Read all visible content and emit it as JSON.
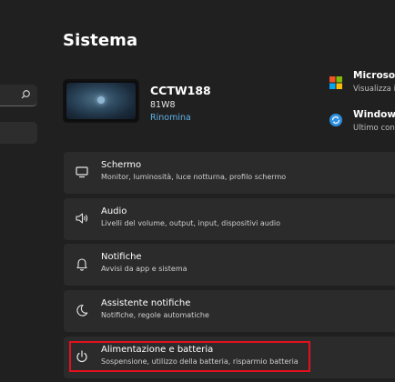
{
  "page": {
    "title": "Sistema"
  },
  "device": {
    "name": "CCTW188",
    "model": "81W8",
    "rename_label": "Rinomina"
  },
  "promos": [
    {
      "title": "Microsoft",
      "subtitle": "Visualizza i v",
      "icon": "microsoft-logo-icon"
    },
    {
      "title": "Windows U",
      "subtitle": "Ultimo cont",
      "icon": "windows-update-icon"
    }
  ],
  "settings": [
    {
      "title": "Schermo",
      "subtitle": "Monitor, luminosità, luce notturna, profilo schermo",
      "icon": "display-icon"
    },
    {
      "title": "Audio",
      "subtitle": "Livelli del volume, output, input, dispositivi audio",
      "icon": "speaker-icon"
    },
    {
      "title": "Notifiche",
      "subtitle": "Avvisi da app e sistema",
      "icon": "bell-icon"
    },
    {
      "title": "Assistente notifiche",
      "subtitle": "Notifiche, regole automatiche",
      "icon": "moon-icon"
    },
    {
      "title": "Alimentazione e batteria",
      "subtitle": "Sospensione, utilizzo della batteria, risparmio batteria",
      "icon": "power-icon"
    }
  ],
  "colors": {
    "background": "#202020",
    "card": "#2b2b2b",
    "accent_link": "#5fb2e8",
    "highlight": "#e3101e"
  }
}
